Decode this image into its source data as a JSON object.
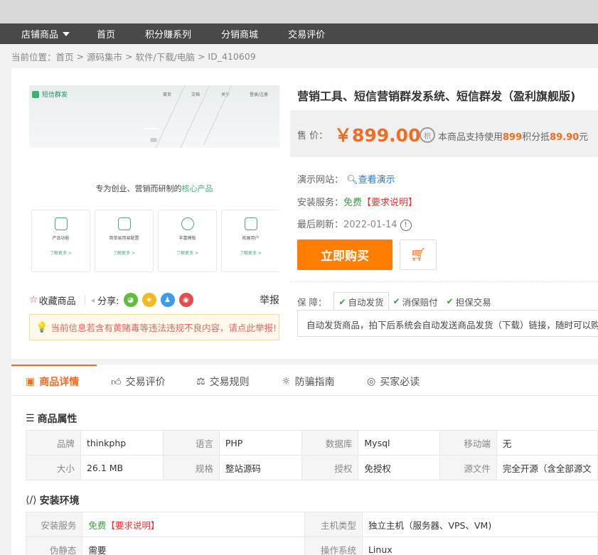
{
  "nav": {
    "items": [
      "店铺商品",
      "首页",
      "积分赚系列",
      "分销商城",
      "交易评价"
    ]
  },
  "breadcrumb": [
    "当前位置：首页",
    ">",
    "源码集市",
    ">",
    "软件/下载/电脑",
    ">",
    "ID_410609"
  ],
  "gallery": {
    "logo": "短信群发",
    "bnav": [
      "首页",
      "文档",
      "关于",
      "登录/注册"
    ],
    "slogan_pre": "专为创业、营销而研制的",
    "slogan_hl": "核心产品",
    "cards": [
      {
        "title": "产品功能",
        "link": "了解更多 >"
      },
      {
        "title": "简单易用易配置",
        "link": "了解更多 >"
      },
      {
        "title": "丰富模板",
        "link": "了解更多 >"
      },
      {
        "title": "拓展用户",
        "link": "了解更多 >"
      }
    ]
  },
  "social": {
    "fav": "收藏商品",
    "share": "分享:",
    "report": "举报",
    "icons": [
      "wechat-icon",
      "qzone-icon",
      "qq-icon",
      "weibo-icon"
    ],
    "colors": [
      "#5fbf3a",
      "#f5b823",
      "#3b9bef",
      "#e84b4b"
    ]
  },
  "notice": "当前信息若含有黄赌毒等违法违规不良内容，请点此举报!",
  "product": {
    "title": "营销工具、短信营销群发系统、短信群发（盈利旗舰版)",
    "price_label": "售  价：",
    "price": "￥899.00",
    "coin_icon": "积",
    "points_pre": "本商品支持使用",
    "points_num": "899",
    "points_mid": "积分抵",
    "points_amount": "89.90",
    "points_suf": "元",
    "demo_label": "演示网站：",
    "demo_link": "查看演示",
    "service_label": "安装服务：",
    "service_free": "免费",
    "service_req": "【要求说明】",
    "refresh_label": "最后刷新：",
    "refresh_date": "2022-01-14",
    "buy": "立即购买",
    "guarantee_label": "保  障：",
    "guarantees": [
      "自动发货",
      "消保赔付",
      "担保交易"
    ],
    "guarantee_desc": "自动发货商品，拍下后系统会自动发送商品发货（下载）链接，随时可以购买,"
  },
  "tabs": [
    "商品详情",
    "交易评价",
    "交易规则",
    "防骗指南",
    "买家必读"
  ],
  "attr_title": "商品属性",
  "attrs": [
    [
      "品牌",
      "thinkphp",
      "语言",
      "PHP",
      "数据库",
      "Mysql",
      "移动端",
      "无"
    ],
    [
      "大小",
      "26.1 MB",
      "规格",
      "整站源码",
      "授权",
      "免授权",
      "源文件",
      "完全开源（含全部源文"
    ]
  ],
  "env_title": "安装环境",
  "env": [
    [
      "安装服务",
      "免费",
      "【要求说明】",
      "主机类型",
      "独立主机（服务器、VPS、VM)"
    ],
    [
      "伪静态",
      "需要",
      "",
      "操作系统",
      "Linux"
    ]
  ],
  "accent": "#f26c1f"
}
